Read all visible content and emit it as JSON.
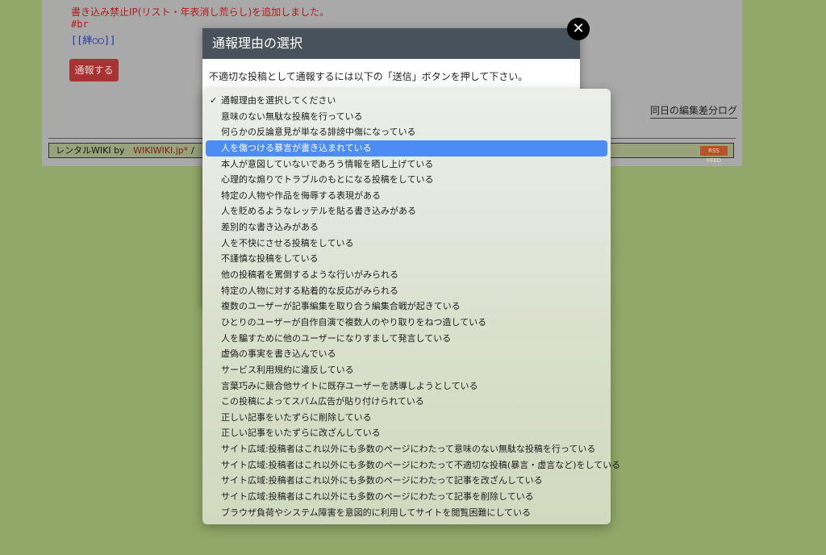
{
  "background_page": {
    "notice_line": "書き込み禁止IP(リスト・年表消し荒らし)を追加しました。",
    "br_line": "#br",
    "link_line": "[[絆○○]]",
    "report_button": "通報する",
    "diff_log_link": "同日の編集差分ログ",
    "footer": {
      "rental_text": "レンタルWIKI by",
      "site_link": "WIKIWIKI.jp*",
      "slash": "/",
      "rss_label": "RSS FEED"
    }
  },
  "modal": {
    "title": "通報理由の選択",
    "description": "不適切な投稿として通報するには以下の「送信」ボタンを押して下さい。",
    "close_icon": "close-icon"
  },
  "dropdown": {
    "selected_index": 0,
    "highlighted_index": 3,
    "options": [
      "通報理由を選択してください",
      "意味のない無駄な投稿を行っている",
      "何らかの反論意見が単なる誹謗中傷になっている",
      "人を傷つける暴言が書き込まれている",
      "本人が意図していないであろう情報を晒し上げている",
      "心理的な煽りでトラブルのもとになる投稿をしている",
      "特定の人物や作品を侮辱する表現がある",
      "人を貶めるようなレッテルを貼る書き込みがある",
      "差別的な書き込みがある",
      "人を不快にさせる投稿をしている",
      "不謹慎な投稿をしている",
      "他の投稿者を罵倒するような行いがみられる",
      "特定の人物に対する粘着的な反応がみられる",
      "複数のユーザーが記事編集を取り合う編集合戦が起きている",
      "ひとりのユーザーが自作自演で複数人のやり取りをねつ造している",
      "人を騙すために他のユーザーになりすまして発言している",
      "虚偽の事実を書き込んでいる",
      "サービス利用規約に違反している",
      "言葉巧みに競合他サイトに既存ユーザーを誘導しようとしている",
      "この投稿によってスパム広告が貼り付けられている",
      "正しい記事をいたずらに削除している",
      "正しい記事をいたずらに改ざんしている",
      "サイト広域:投稿者はこれ以外にも多数のページにわたって意味のない無駄な投稿を行っている",
      "サイト広域:投稿者はこれ以外にも多数のページにわたって不適切な投稿(暴言・虚言など)をしている",
      "サイト広域:投稿者はこれ以外にも多数のページにわたって記事を改ざんしている",
      "サイト広域:投稿者はこれ以外にも多数のページにわたって記事を削除している",
      "ブラウザ負荷やシステム障害を意図的に利用してサイトを閲覧困難にしている"
    ]
  }
}
